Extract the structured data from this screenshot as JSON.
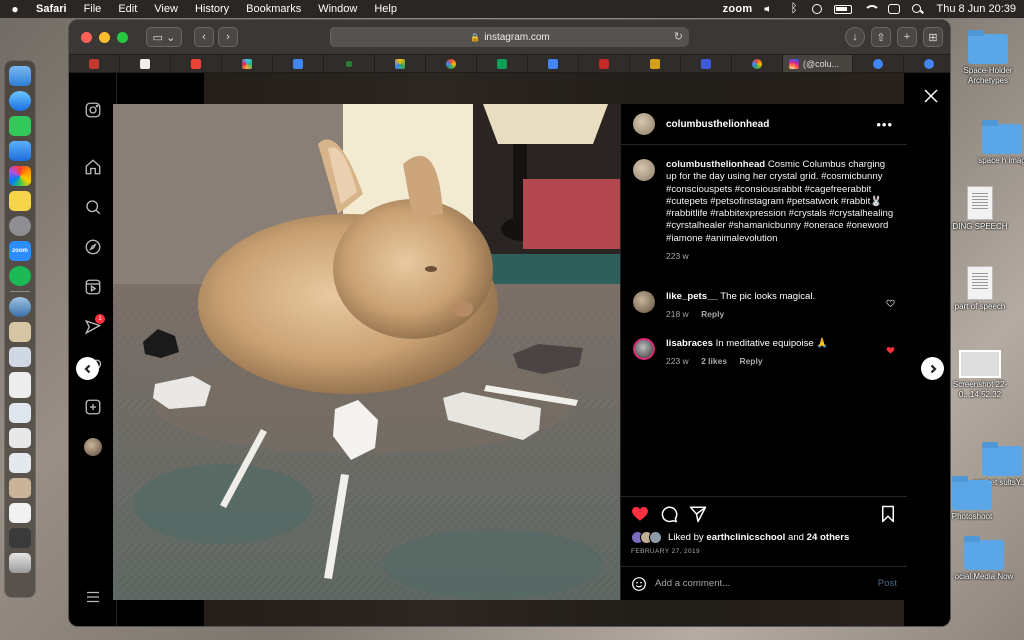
{
  "menubar": {
    "app_name": "Safari",
    "menus": [
      "File",
      "Edit",
      "View",
      "History",
      "Bookmarks",
      "Window",
      "Help"
    ],
    "zoom_label": "zoom",
    "datetime": "Thu 8 Jun  20:39"
  },
  "browser": {
    "url": "instagram.com",
    "active_tab_label": "(@colu...",
    "tabs": [
      "shield",
      "pin",
      "gmail",
      "slack",
      "calendar",
      "dot",
      "drive",
      "google",
      "sheets",
      "docs",
      "red",
      "gold",
      "cast",
      "google",
      "instagram",
      "chrome",
      "chrome"
    ]
  },
  "desktop": {
    "icons": [
      {
        "label": "Space-Holder Archetypes",
        "kind": "folder"
      },
      {
        "label": "space h imag",
        "kind": "folder"
      },
      {
        "label": "DING SPEECH",
        "kind": "doc"
      },
      {
        "label": "part of speech",
        "kind": "doc"
      },
      {
        "label": "Screenshot 22-0...14.52.32",
        "kind": "shot"
      },
      {
        "label": "get bet sultsY...h",
        "kind": "folder"
      },
      {
        "label": "Photoshoot",
        "kind": "folder"
      },
      {
        "label": "ocial Media Now",
        "kind": "folder"
      }
    ]
  },
  "post": {
    "username": "columbusthelionhead",
    "caption": "Cosmic Columbus charging up for the day using her crystal grid. #cosmicbunny #consciouspets #consiousrabbit #cagefreerabbit #cutepets #petsofinstagram #petsatwork #rabbit🐰 #rabbitlife #rabbitexpression #crystals #crystalhealing #cyrstalhealer #shamanicbunny #onerace #oneword #iamone #animalevolution",
    "caption_time": "223 w",
    "comments": [
      {
        "user": "like_pets__",
        "text": "The pic looks magical.",
        "time": "218 w",
        "likes": "",
        "reply": "Reply",
        "liked": false
      },
      {
        "user": "lisabraces",
        "text": "In meditative equipoise 🙏",
        "time": "223 w",
        "likes": "2 likes",
        "reply": "Reply",
        "liked": true
      }
    ],
    "liked_by_prefix": "Liked by",
    "liked_by_user": "earthclinicschool",
    "liked_by_joiner": "and",
    "liked_by_others": "24 others",
    "date": "FEBRUARY 27, 2019",
    "comment_placeholder": "Add a comment...",
    "post_label": "Post",
    "notification_badge": "1"
  }
}
